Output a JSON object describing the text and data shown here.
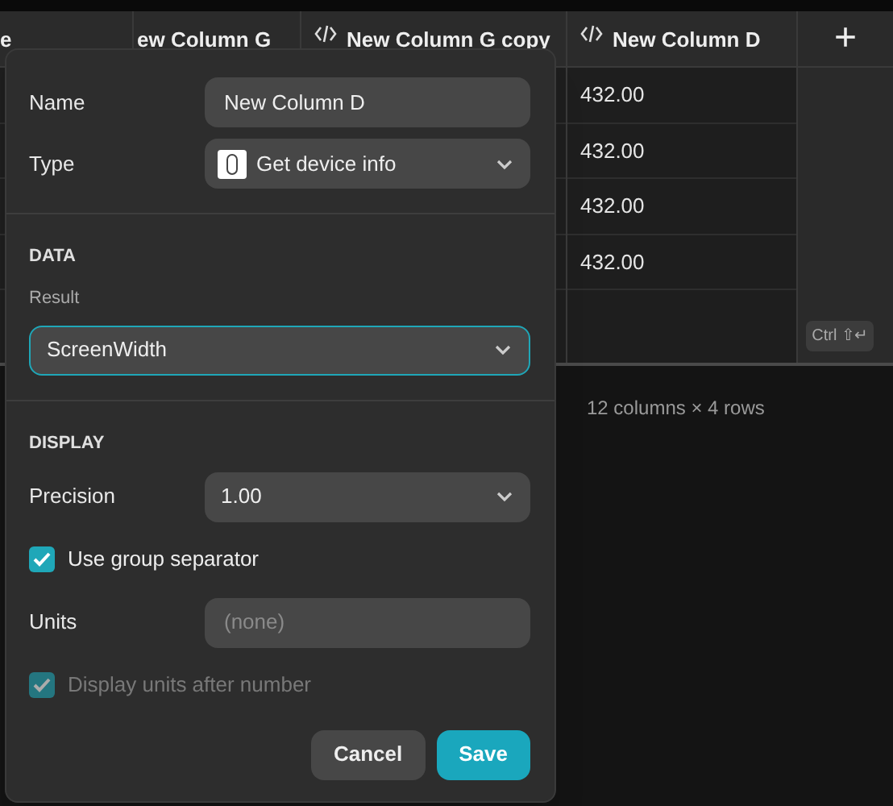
{
  "table": {
    "columns": [
      {
        "label": "e",
        "code": false
      },
      {
        "label": "ew Column G",
        "code": false
      },
      {
        "label": "New Column G copy",
        "code": true
      },
      {
        "label": "New Column D",
        "code": true
      }
    ],
    "add_column": "+",
    "rows": [
      {
        "cells": [
          "432.00"
        ]
      },
      {
        "cells": [
          "432.00"
        ]
      },
      {
        "cells": [
          "432.00"
        ]
      },
      {
        "cells": [
          "432.00"
        ]
      }
    ],
    "shortcut_hint": "Ctrl ⇧↵",
    "summary": "12 columns × 4 rows"
  },
  "dialog": {
    "name": {
      "label": "Name",
      "value": "New Column D"
    },
    "type": {
      "label": "Type",
      "value": "Get device info"
    },
    "sections": [
      {
        "title": "DATA",
        "fields": [
          {
            "kind": "stacked-select",
            "label": "Result",
            "value": "ScreenWidth",
            "focused": true
          }
        ]
      },
      {
        "title": "DISPLAY",
        "fields": [
          {
            "kind": "select",
            "label": "Precision",
            "value": "1.00"
          },
          {
            "kind": "checkbox",
            "label": "Use group separator",
            "checked": true,
            "disabled": false
          },
          {
            "kind": "input",
            "label": "Units",
            "placeholder": "(none)"
          },
          {
            "kind": "checkbox",
            "label": "Display units after number",
            "checked": true,
            "disabled": true
          }
        ]
      }
    ],
    "buttons": [
      {
        "label": "Cancel",
        "primary": false
      },
      {
        "label": "Save",
        "primary": true
      }
    ]
  }
}
